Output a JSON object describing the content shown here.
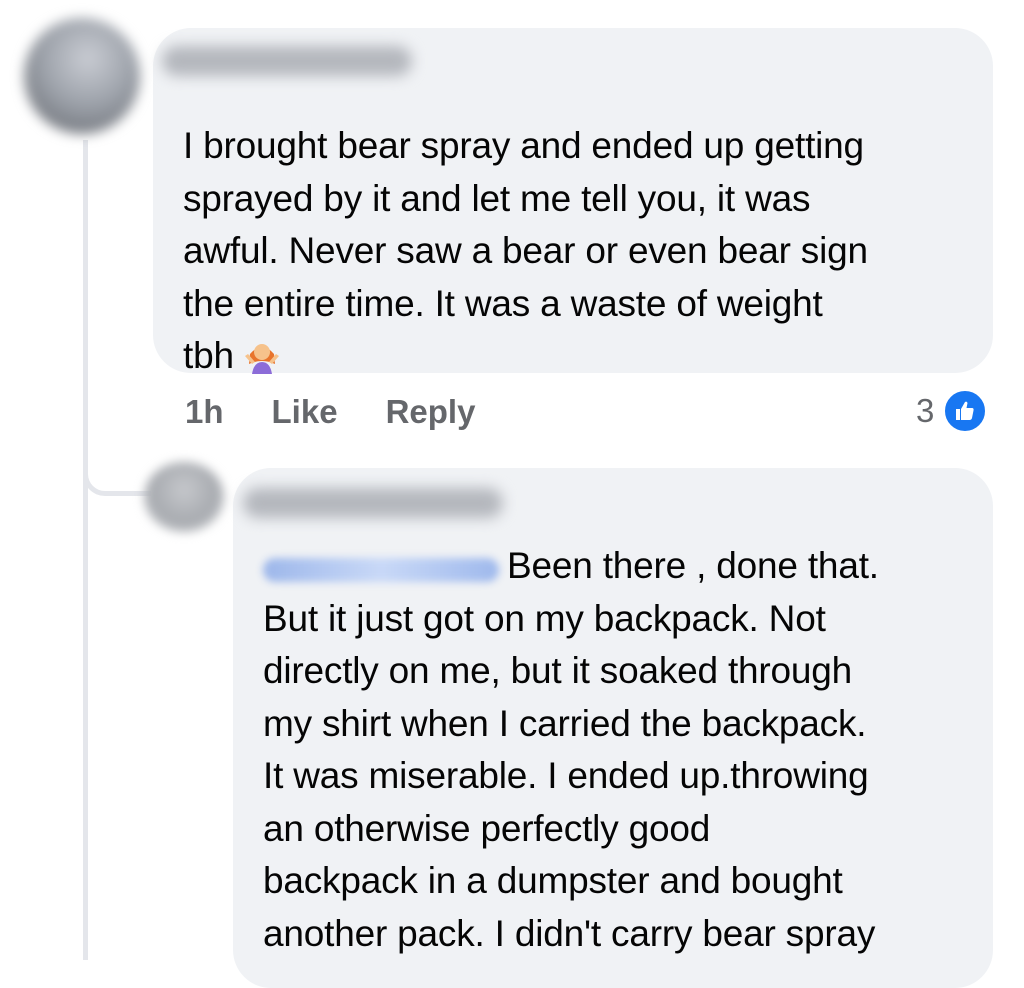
{
  "comments": [
    {
      "text": "I brought bear spray and ended up getting\nsprayed by it and let me tell you, it was\nawful. Never saw a bear or even bear sign\nthe entire time. It was a waste of weight\ntbh",
      "emoji": "woman-shrugging-emoji",
      "time": "1h",
      "like_label": "Like",
      "reply_label": "Reply",
      "reaction_count": "3",
      "reaction_icon": "like-icon",
      "accent_color": "#1877f2"
    },
    {
      "text": "Been there , done that.\nBut it just got on my backpack. Not\ndirectly on me,  but it soaked through\nmy shirt when I carried the backpack.\nIt was miserable. I ended up.throwing\nan otherwise perfectly good\nbackpack in a dumpster and bought\nanother pack. I didn't carry bear spray"
    }
  ]
}
